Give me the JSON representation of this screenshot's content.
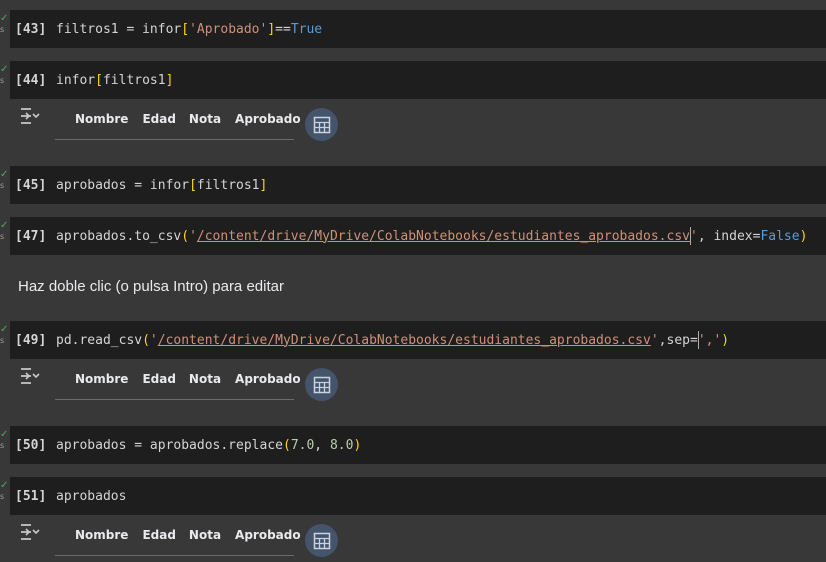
{
  "status": {
    "check": "✓",
    "secs": "s"
  },
  "cells": {
    "c43": {
      "prompt": "[43]"
    },
    "c44": {
      "prompt": "[44]"
    },
    "c45": {
      "prompt": "[45]"
    },
    "c47": {
      "prompt": "[47]"
    },
    "c49": {
      "prompt": "[49]"
    },
    "c50": {
      "prompt": "[50]"
    },
    "c51": {
      "prompt": "[51]",
      "code": "aprobados"
    }
  },
  "code": {
    "c43": {
      "pre": "filtros1 = infor",
      "lb": "[",
      "str": "'Aprobado'",
      "rb": "]",
      "op": "==",
      "kw": "True"
    },
    "c44": {
      "pre": "infor",
      "lb": "[",
      "inner": "filtros1",
      "rb": "]"
    },
    "c45": {
      "pre": "aprobados = infor",
      "lb": "[",
      "inner": "filtros1",
      "rb": "]"
    },
    "c47": {
      "pre": "aprobados.to_csv",
      "lp": "(",
      "q1": "'",
      "path": "/content/drive/MyDrive/ColabNotebooks/estudiantes_aprobados.csv",
      "q2": "'",
      "mid": ", index=",
      "kw": "False",
      "rp": ")"
    },
    "c49": {
      "pre": "pd.read_csv",
      "lp": "(",
      "q1": "'",
      "path": "/content/drive/MyDrive/ColabNotebooks/estudiantes_aprobados.csv",
      "q2": "'",
      "mid": ",sep=",
      "sep": "','",
      "rp": ")"
    },
    "c50": {
      "pre": "aprobados = aprobados.replace",
      "lp": "(",
      "n1": "7.0",
      "comma": ", ",
      "n2": "8.0",
      "rp": ")"
    }
  },
  "markdown": {
    "text": "Haz doble clic (o pulsa Intro) para editar"
  },
  "dataframe": {
    "columns": [
      "Nombre",
      "Edad",
      "Nota",
      "Aprobado"
    ]
  },
  "icons": {
    "output": "output-toggle-icon",
    "table": "table-view-icon"
  },
  "colors": {
    "bg": "#383838",
    "cell": "#1e1e1e",
    "string": "#ce9178",
    "keyword": "#569cd6",
    "bracket": "#ffd700",
    "number": "#b5cea8"
  }
}
